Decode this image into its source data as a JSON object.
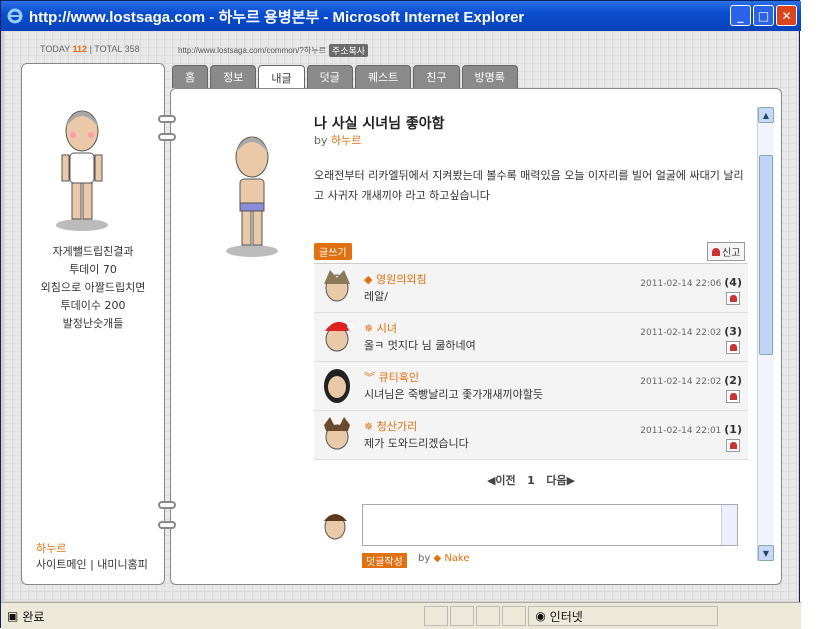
{
  "window": {
    "title": "http://www.lostsaga.com - 하누르 용병본부 - Microsoft Internet Explorer"
  },
  "counter": {
    "today_label": "TODAY",
    "today_value": "112",
    "total_label": "TOTAL",
    "total_value": "358"
  },
  "url": {
    "text": "http://www.lostsaga.com/common/?하누르",
    "copy_label": "주소복사"
  },
  "tabs": [
    "홈",
    "정보",
    "내글",
    "덧글",
    "퀘스트",
    "친구",
    "방명록"
  ],
  "profile": {
    "lines": [
      "자게뺄드립친결과",
      "투데이 70",
      "외침으로 아짤드립치면",
      "투데이수 200",
      "발정난숫개들"
    ],
    "name": "하누르",
    "links": "사이트메인 | 내미니홈피"
  },
  "post": {
    "title": "나 사실 시녀님 좋아함",
    "by_label": "by",
    "author": "하누르",
    "body": "오래전부터 리카엘뒤에서 지켜봤는데 볼수록 매력있음 오늘 이자리를 빌어 얼굴에 싸대기 날리고 사귀자 개새끼야 라고 하고싶습니다",
    "write_label": "글쓰기",
    "report_label": "신고"
  },
  "comments": [
    {
      "name": "영원의외침",
      "text": "레알/",
      "date": "2011-02-14 22:06",
      "num": "(4)"
    },
    {
      "name": "시녀",
      "text": "올ㅋ 멋지다 님 쿨하네여",
      "date": "2011-02-14 22:02",
      "num": "(3)"
    },
    {
      "name": "큐티혹인",
      "text": "시녀님은 죽빵날리고 좇가개새끼야할듯",
      "date": "2011-02-14 22:02",
      "num": "(2)"
    },
    {
      "name": "청산가리",
      "text": "제가 도와드리겠습니다",
      "date": "2011-02-14 22:01",
      "num": "(1)"
    }
  ],
  "pager": {
    "prev": "◀이전",
    "page": "1",
    "next": "다음▶"
  },
  "reply": {
    "submit": "덧글작성",
    "by": "by",
    "user": "Nake"
  },
  "status": {
    "left": "완료",
    "zone": "인터넷"
  }
}
